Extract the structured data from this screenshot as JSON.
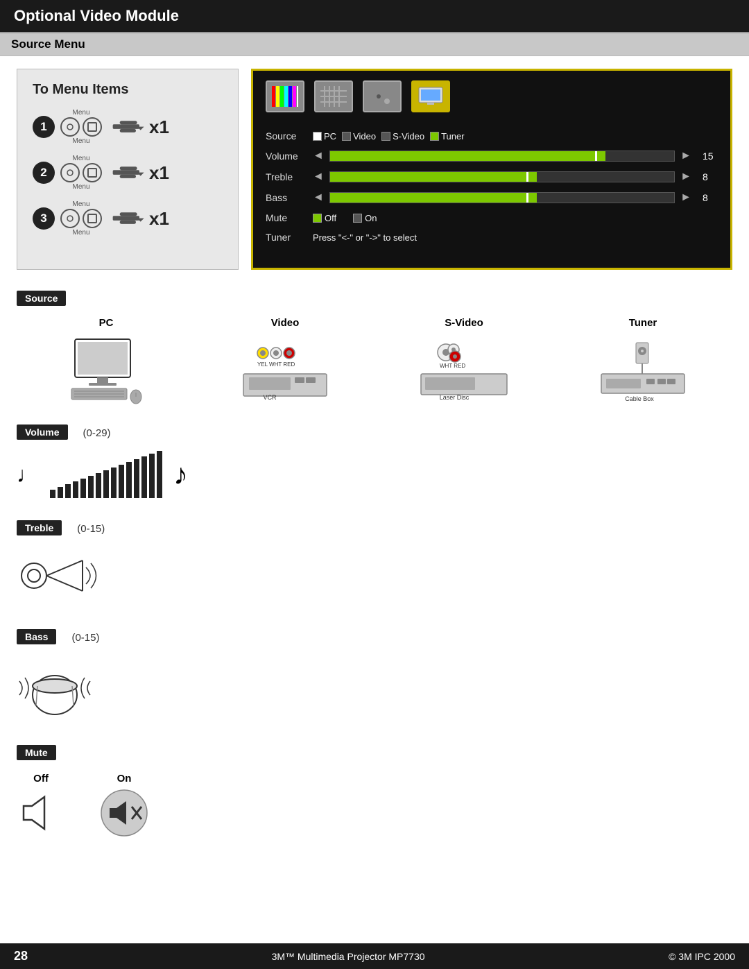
{
  "header": {
    "title": "Optional Video Module"
  },
  "section_header": "Source Menu",
  "diagram": {
    "title": "To Menu Items",
    "steps": [
      {
        "number": "1",
        "label1": "Menu",
        "label2": "Menu",
        "x1": "x1"
      },
      {
        "number": "2",
        "label1": "Menu",
        "label2": "Menu",
        "x1": "x1"
      },
      {
        "number": "3",
        "label1": "Menu",
        "label2": "Menu",
        "x1": "x1"
      }
    ]
  },
  "menu_panel": {
    "source_label": "Source",
    "source_options": [
      "PC",
      "Video",
      "S-Video",
      "Tuner"
    ],
    "volume_label": "Volume",
    "volume_value": "15",
    "treble_label": "Treble",
    "treble_value": "8",
    "bass_label": "Bass",
    "bass_value": "8",
    "mute_label": "Mute",
    "mute_off": "Off",
    "mute_on": "On",
    "tuner_label": "Tuner",
    "tuner_text": "Press \"<-\" or \"->\" to select"
  },
  "source_section": {
    "badge": "Source",
    "devices": [
      {
        "label": "PC"
      },
      {
        "label": "Video"
      },
      {
        "label": "S-Video"
      },
      {
        "label": "Tuner"
      }
    ]
  },
  "volume_section": {
    "badge": "Volume",
    "range": "(0-29)"
  },
  "treble_section": {
    "badge": "Treble",
    "range": "(0-15)"
  },
  "bass_section": {
    "badge": "Bass",
    "range": "(0-15)"
  },
  "mute_section": {
    "badge": "Mute",
    "off_label": "Off",
    "on_label": "On"
  },
  "footer": {
    "page_number": "28",
    "title": "3M™ Multimedia Projector MP7730",
    "copyright": "© 3M IPC 2000"
  }
}
